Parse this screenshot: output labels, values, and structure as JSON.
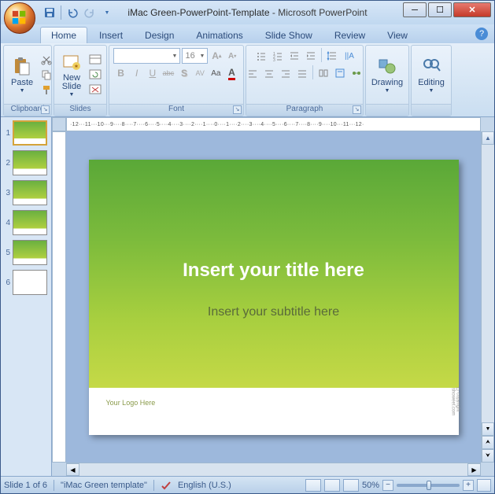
{
  "title": {
    "document": "iMac Green-PowerPoint-Template",
    "app": "Microsoft PowerPoint"
  },
  "qat": {
    "save": "save",
    "undo": "undo",
    "redo": "redo",
    "dd": "▼"
  },
  "tabs": [
    "Home",
    "Insert",
    "Design",
    "Animations",
    "Slide Show",
    "Review",
    "View"
  ],
  "ribbon": {
    "clipboard": {
      "label": "Clipboard",
      "paste": "Paste"
    },
    "slides": {
      "label": "Slides",
      "new_slide": "New\nSlide"
    },
    "font": {
      "label": "Font",
      "name_placeholder": "",
      "size_placeholder": "16",
      "bold": "B",
      "italic": "I",
      "underline": "U",
      "strike": "abc",
      "shadow": "S",
      "char_spacing": "AV",
      "change_case": "Aa",
      "grow": "A",
      "shrink": "A",
      "clear_fmt": "A"
    },
    "paragraph": {
      "label": "Paragraph"
    },
    "drawing": {
      "label": "Drawing",
      "btn": "Drawing"
    },
    "editing": {
      "label": "Editing",
      "btn": "Editing"
    }
  },
  "thumbs": [
    {
      "n": "1",
      "kind": "green",
      "sel": true
    },
    {
      "n": "2",
      "kind": "green",
      "sel": false
    },
    {
      "n": "3",
      "kind": "green",
      "sel": false
    },
    {
      "n": "4",
      "kind": "green",
      "sel": false
    },
    {
      "n": "5",
      "kind": "green",
      "sel": false
    },
    {
      "n": "6",
      "kind": "white",
      "sel": false
    }
  ],
  "ruler": "·12···11···10···9····8····7····6····5····4····3····2····1····0····1····2····3····4····5····6····7····8····9····10···11···12·",
  "slide": {
    "title": "Insert your title here",
    "subtitle": "Insert your subtitle here",
    "logo": "Your Logo Here",
    "copy": "©copyright showeet.com"
  },
  "status": {
    "slide": "Slide 1 of 6",
    "theme": "\"iMac Green template\"",
    "lang": "English (U.S.)",
    "zoom": "50%"
  }
}
